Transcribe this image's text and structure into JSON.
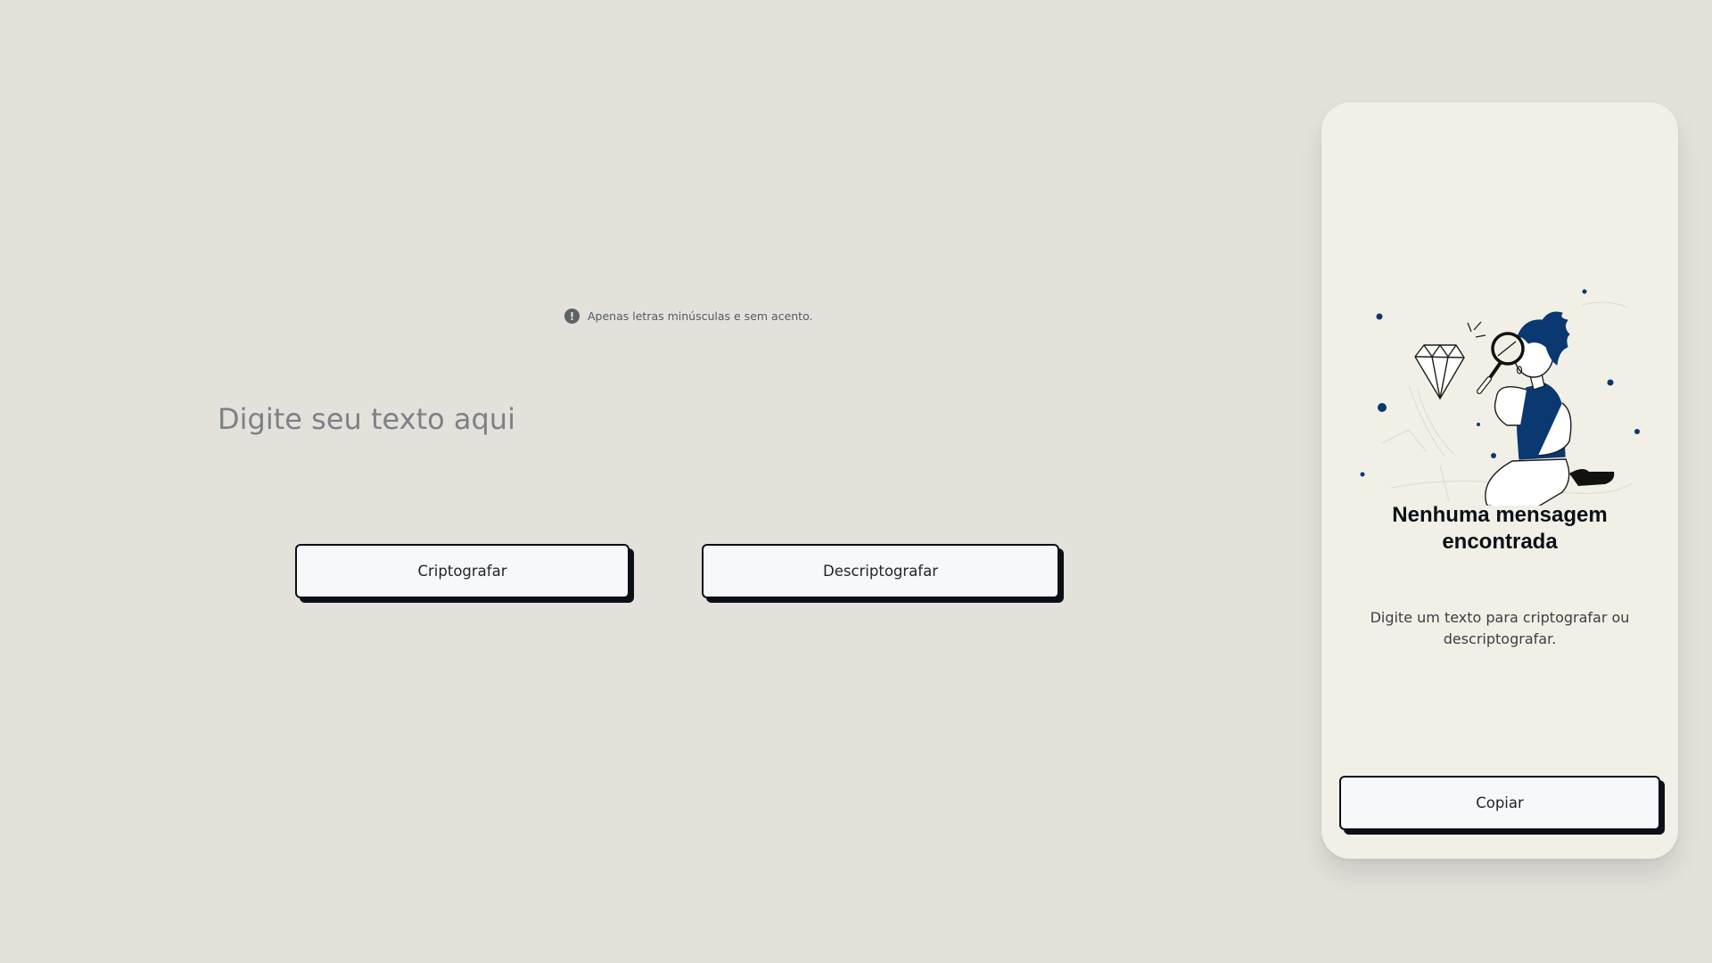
{
  "info": {
    "icon": "exclamation-icon",
    "text": "Apenas letras minúsculas e sem acento."
  },
  "input": {
    "placeholder": "Digite seu texto aqui",
    "value": ""
  },
  "actions": {
    "encrypt_label": "Criptografar",
    "decrypt_label": "Descriptografar"
  },
  "output": {
    "illustration": "person-magnifying-glass-diamond-illustration",
    "title": "Nenhuma mensagem encontrada",
    "description": "Digite um texto para criptografar ou descriptografar.",
    "copy_label": "Copiar"
  },
  "colors": {
    "background": "#e4e1db",
    "panel": "#f2f0e6",
    "button": "#f7f8fa",
    "border_shadow": "#0b0f17",
    "accent_blue": "#0a3871"
  }
}
